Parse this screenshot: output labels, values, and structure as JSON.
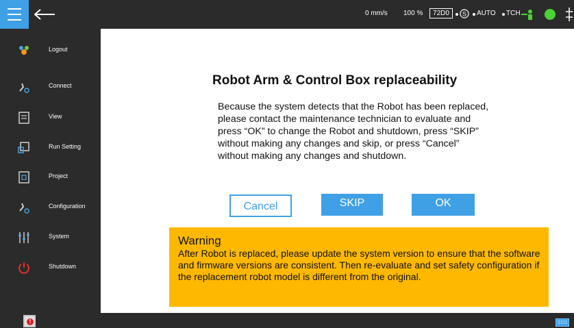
{
  "status": {
    "speed": "0 mm/s",
    "percent": "100 %",
    "code": "72D0",
    "mode": "AUTO",
    "tch": "TCH",
    "indicator_color": "#4cd137"
  },
  "sidebar": {
    "items": [
      {
        "label": "Logout",
        "icon": "users-icon"
      },
      {
        "label": "Connect",
        "icon": "connect-icon"
      },
      {
        "label": "View",
        "icon": "view-icon"
      },
      {
        "label": "Run Setting",
        "icon": "run-setting-icon"
      },
      {
        "label": "Project",
        "icon": "project-icon"
      },
      {
        "label": "Configuration",
        "icon": "configuration-icon"
      },
      {
        "label": "System",
        "icon": "system-icon"
      },
      {
        "label": "Shutdown",
        "icon": "power-icon"
      }
    ]
  },
  "dialog": {
    "title": "Robot Arm & Control Box replaceability",
    "message": "Because the system detects that the Robot has been replaced, please contact the maintenance technician to evaluate and press “OK” to change the Robot and shutdown, press “SKIP” without making any changes and skip, or press “Cancel” without making any changes and shutdown.",
    "cancel_label": "Cancel",
    "skip_label": "SKIP",
    "ok_label": "OK"
  },
  "warning": {
    "title": "Warning",
    "text": "After Robot is replaced, please update the system version to ensure that the software and firmware versions are consistent. Then re-evaluate and set safety configuration if the replacement robot model is different from the original."
  },
  "colors": {
    "accent": "#3fa0e6",
    "warning": "#ffb800",
    "bar": "#2b2b2b"
  }
}
